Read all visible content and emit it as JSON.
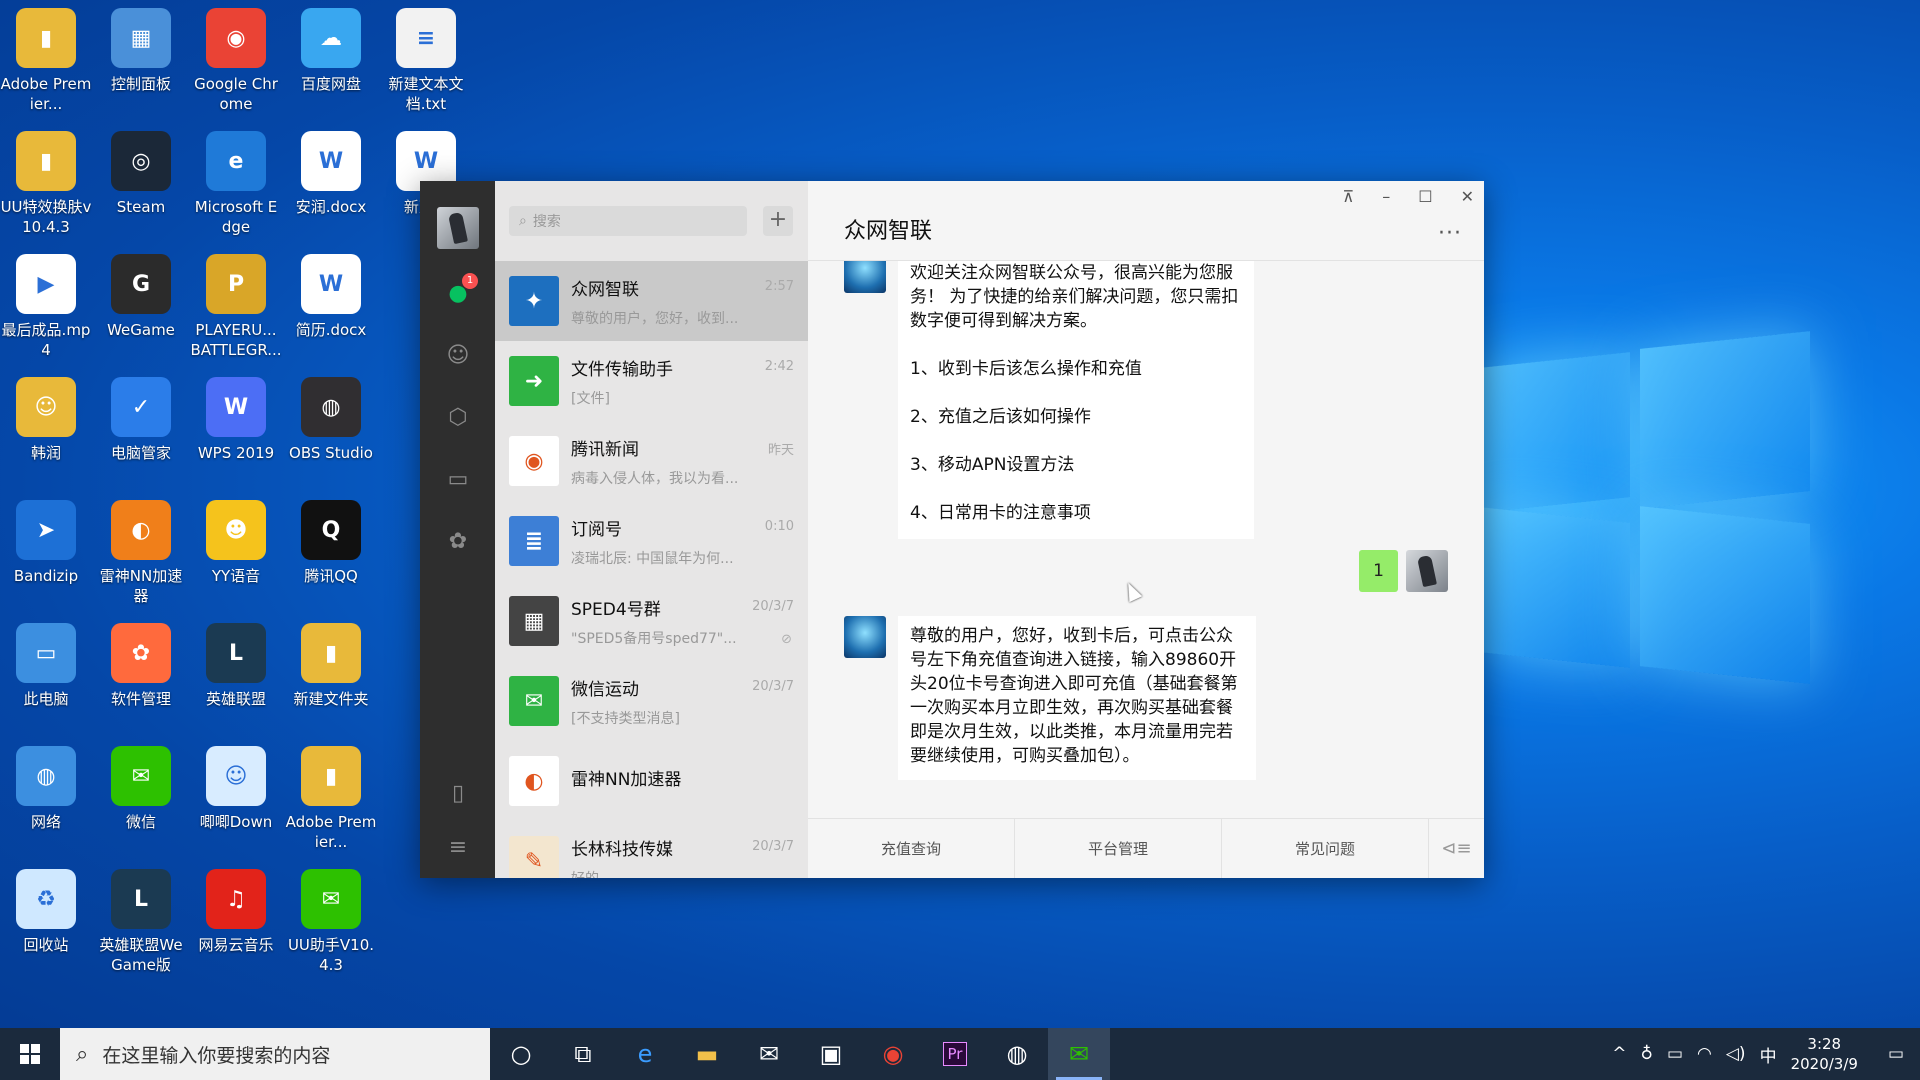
{
  "desktop": {
    "icons": [
      {
        "label": "Adobe Premier...",
        "color": "#e8b93a",
        "glyph": "▮"
      },
      {
        "label": "控制面板",
        "color": "#4a90d9",
        "glyph": "▦"
      },
      {
        "label": "Google Chrome",
        "color": "#ea4335",
        "glyph": "◉"
      },
      {
        "label": "百度网盘",
        "color": "#39a7f0",
        "glyph": "☁"
      },
      {
        "label": "新建文本文档.txt",
        "color": "#f2f2f2",
        "glyph": "≡"
      },
      {
        "label": "UU特效换肤v10.4.3",
        "color": "#e8b93a",
        "glyph": "▮"
      },
      {
        "label": "Steam",
        "color": "#1b2838",
        "glyph": "◎"
      },
      {
        "label": "Microsoft Edge",
        "color": "#1f7ad8",
        "glyph": "e"
      },
      {
        "label": "安润.docx",
        "color": "#ffffff",
        "glyph": "W"
      },
      {
        "label": "新建...",
        "color": "#ffffff",
        "glyph": "W"
      },
      {
        "label": "最后成品.mp4",
        "color": "#ffffff",
        "glyph": "▶"
      },
      {
        "label": "WeGame",
        "color": "#2b2b2b",
        "glyph": "G"
      },
      {
        "label": "PLAYERU... BATTLEGR...",
        "color": "#d9a628",
        "glyph": "P"
      },
      {
        "label": "简历.docx",
        "color": "#ffffff",
        "glyph": "W"
      },
      {
        "label": "韩润",
        "color": "#e8b93a",
        "glyph": "☺"
      },
      {
        "label": "电脑管家",
        "color": "#2b7de9",
        "glyph": "✓"
      },
      {
        "label": "WPS 2019",
        "color": "#4c6ef5",
        "glyph": "W"
      },
      {
        "label": "OBS Studio",
        "color": "#302e31",
        "glyph": "◍"
      },
      {
        "label": "Bandizip",
        "color": "#1d70d6",
        "glyph": "➤"
      },
      {
        "label": "雷神NN加速器",
        "color": "#f07f1a",
        "glyph": "◐"
      },
      {
        "label": "YY语音",
        "color": "#f5c31c",
        "glyph": "☻"
      },
      {
        "label": "腾讯QQ",
        "color": "#111111",
        "glyph": "Q"
      },
      {
        "label": "此电脑",
        "color": "#3c8fe0",
        "glyph": "▭"
      },
      {
        "label": "软件管理",
        "color": "#ff6a3d",
        "glyph": "✿"
      },
      {
        "label": "英雄联盟",
        "color": "#1b3a52",
        "glyph": "L"
      },
      {
        "label": "新建文件夹",
        "color": "#e8b93a",
        "glyph": "▮"
      },
      {
        "label": "网络",
        "color": "#3c8fe0",
        "glyph": "◍"
      },
      {
        "label": "微信",
        "color": "#2dc100",
        "glyph": "✉"
      },
      {
        "label": "唧唧Down",
        "color": "#d8ecff",
        "glyph": "☺"
      },
      {
        "label": "Adobe Premier...",
        "color": "#e8b93a",
        "glyph": "▮"
      },
      {
        "label": "回收站",
        "color": "#cfe8ff",
        "glyph": "♻"
      },
      {
        "label": "英雄联盟WeGame版",
        "color": "#1b3a52",
        "glyph": "L"
      },
      {
        "label": "网易云音乐",
        "color": "#e2231a",
        "glyph": "♫"
      },
      {
        "label": "UU助手V10.4.3",
        "color": "#2dc100",
        "glyph": "✉"
      }
    ]
  },
  "wechat": {
    "search_placeholder": "搜索",
    "plus": "+",
    "badge": "1",
    "chats": [
      {
        "name": "众网智联",
        "preview": "尊敬的用户，您好，收到...",
        "time": "2:57",
        "color": "#1d6fbf",
        "glyph": "✦",
        "active": true
      },
      {
        "name": "文件传输助手",
        "preview": "[文件]",
        "time": "2:42",
        "color": "#2fb344",
        "glyph": "➜"
      },
      {
        "name": "腾讯新闻",
        "preview": "病毒入侵人体，我以为看...",
        "time": "昨天",
        "color": "#ffffff",
        "glyph": "◉"
      },
      {
        "name": "订阅号",
        "preview": "凌瑞北辰: 中国鼠年为何...",
        "time": "0:10",
        "color": "#3d7fd6",
        "glyph": "≣"
      },
      {
        "name": "SPED4号群",
        "preview": "\"SPED5备用号sped77\"...",
        "time": "20/3/7",
        "color": "#444444",
        "glyph": "▦"
      },
      {
        "name": "微信运动",
        "preview": "[不支持类型消息]",
        "time": "20/3/7",
        "color": "#2fb344",
        "glyph": "✉"
      },
      {
        "name": "雷神NN加速器",
        "preview": "",
        "time": "",
        "color": "#ffffff",
        "glyph": "◐"
      },
      {
        "name": "长林科技传媒",
        "preview": "好的",
        "time": "20/3/7",
        "color": "#f3e6cf",
        "glyph": "✎"
      }
    ],
    "conversation": {
      "title": "众网智联",
      "window_controls": [
        "⊼",
        "–",
        "☐",
        "✕"
      ],
      "more": "···",
      "msg1": {
        "intro": "欢迎关注众网智联公众号，很高兴能为您服务！ 为了快捷的给亲们解决问题，您只需扣数字便可得到解决方案。",
        "items": [
          "1、收到卡后该怎么操作和充值",
          "2、充值之后该如何操作",
          "3、移动APN设置方法",
          "4、日常用卡的注意事项"
        ]
      },
      "my_msg": "1",
      "msg2": "尊敬的用户，您好，收到卡后，可点击公众号左下角充值查询进入链接，输入89860开头20位卡号查询进入即可充值（基础套餐第一次购买本月立即生效，再次购买基础套餐即是次月生效，以此类推，本月流量用完若要继续使用，可购买叠加包）。",
      "menu": [
        "充值查询",
        "平台管理",
        "常见问题"
      ],
      "menu_toggle": "⊲≡"
    }
  },
  "taskbar": {
    "search_placeholder": "在这里输入你要搜索的内容",
    "ime": "中",
    "time": "3:28",
    "date": "2020/3/9"
  }
}
